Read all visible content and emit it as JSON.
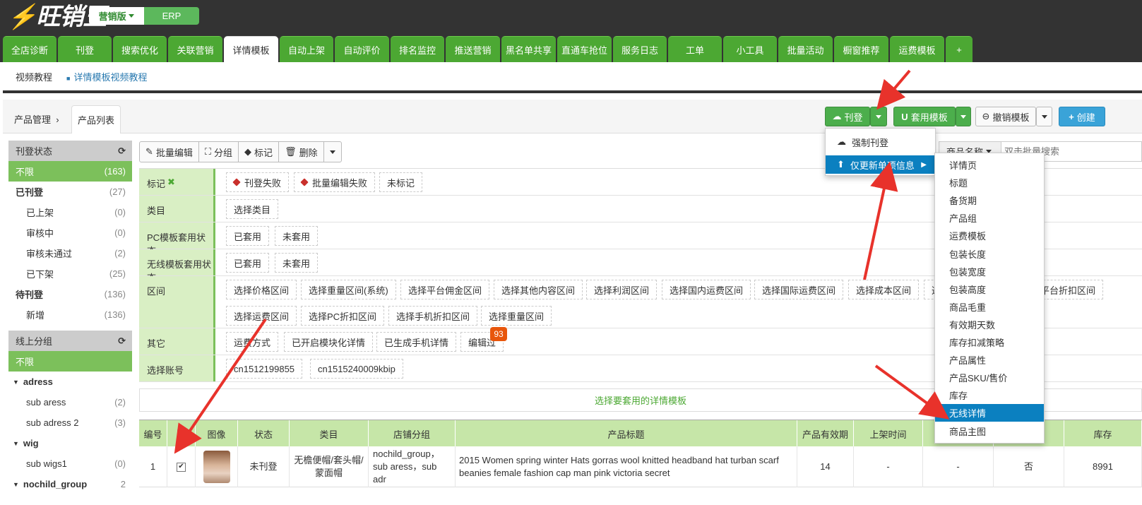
{
  "app": {
    "logo": "旺销王",
    "edition": "营销版",
    "erp": "ERP"
  },
  "nav_tabs": [
    "全店诊断",
    "刊登",
    "搜索优化",
    "关联营销",
    "详情模板",
    "自动上架",
    "自动评价",
    "排名监控",
    "推送营销",
    "黑名单共享",
    "直通车抢位",
    "服务日志",
    "工单",
    "小工具",
    "批量活动",
    "橱窗推荐",
    "运费模板",
    "+"
  ],
  "active_tab": "详情模板",
  "subnav": {
    "tutorial": "视频教程",
    "detail_tutorial": "详情模板视频教程"
  },
  "breadcrumb": {
    "parent": "产品管理",
    "current": "产品列表"
  },
  "actions": {
    "publish": "刊登",
    "apply_template": "套用模板",
    "revoke_template": "撤销模板",
    "create": "创建"
  },
  "publish_menu": {
    "force": "强制刊登",
    "update_single": "仅更新单项信息"
  },
  "update_submenu": [
    "详情页",
    "标题",
    "备货期",
    "产品组",
    "运费模板",
    "包装长度",
    "包装宽度",
    "包装高度",
    "商品毛重",
    "有效期天数",
    "库存扣减策略",
    "产品属性",
    "产品SKU/售价",
    "库存",
    "无线详情",
    "商品主图"
  ],
  "update_submenu_selected": "无线详情",
  "search": {
    "field": "商品名称",
    "placeholder": "双击批量搜索"
  },
  "sidebar": {
    "status_title": "刊登状态",
    "status_items": [
      {
        "label": "不限",
        "count": "(163)",
        "sel": true,
        "bold": false,
        "indent": false
      },
      {
        "label": "已刊登",
        "count": "(27)",
        "sel": false,
        "bold": true,
        "indent": false
      },
      {
        "label": "已上架",
        "count": "(0)",
        "sel": false,
        "bold": false,
        "indent": true
      },
      {
        "label": "审核中",
        "count": "(0)",
        "sel": false,
        "bold": false,
        "indent": true
      },
      {
        "label": "审核未通过",
        "count": "(2)",
        "sel": false,
        "bold": false,
        "indent": true
      },
      {
        "label": "已下架",
        "count": "(25)",
        "sel": false,
        "bold": false,
        "indent": true
      },
      {
        "label": "待刊登",
        "count": "(136)",
        "sel": false,
        "bold": true,
        "indent": false
      },
      {
        "label": "新增",
        "count": "(136)",
        "sel": false,
        "bold": false,
        "indent": true
      }
    ],
    "group_title": "线上分组",
    "group_items": [
      {
        "label": "不限",
        "count": "",
        "sel": true,
        "bold": false,
        "indent": false,
        "tri": false
      },
      {
        "label": "adress",
        "count": "",
        "sel": false,
        "bold": true,
        "indent": false,
        "tri": true
      },
      {
        "label": "sub aress",
        "count": "(2)",
        "sel": false,
        "bold": false,
        "indent": true,
        "tri": false
      },
      {
        "label": "sub adress 2",
        "count": "(3)",
        "sel": false,
        "bold": false,
        "indent": true,
        "tri": false
      },
      {
        "label": "wig",
        "count": "",
        "sel": false,
        "bold": true,
        "indent": false,
        "tri": true
      },
      {
        "label": "sub wigs1",
        "count": "(0)",
        "sel": false,
        "bold": false,
        "indent": true,
        "tri": false
      },
      {
        "label": "nochild_group",
        "count": "2",
        "sel": false,
        "bold": true,
        "indent": false,
        "tri": true
      }
    ]
  },
  "toolbar": {
    "batch_edit": "批量编辑",
    "group": "分组",
    "mark": "标记",
    "delete": "删除"
  },
  "filters": {
    "mark_label": "标记",
    "mark_chips": [
      "刊登失败",
      "批量编辑失败",
      "未标记"
    ],
    "category_label": "类目",
    "category_chips": [
      "选择类目"
    ],
    "pc_label": "PC模板套用状态",
    "pc_chips": [
      "已套用",
      "未套用"
    ],
    "wireless_label": "无线模板套用状态",
    "wireless_chips": [
      "已套用",
      "未套用"
    ],
    "range_label": "区间",
    "range_chips_row1": [
      "选择价格区间",
      "选择重量区间(系统)",
      "选择平台佣金区间",
      "选择其他内容区间",
      "选择利润区间",
      "选择国内运费区间",
      "选择国际运费区间",
      "选择成本区间",
      "选",
      "平台折扣区间"
    ],
    "range_chips_row2": [
      "选择运费区间",
      "选择PC折扣区间",
      "选择手机折扣区间",
      "选择重量区间"
    ],
    "other_label": "其它",
    "other_chips": [
      "运费方式",
      "已开启模块化详情",
      "已生成手机详情",
      "编辑过"
    ],
    "edited_badge": "93",
    "account_label": "选择账号",
    "account_chips": [
      "cn1512199855",
      "cn1515240009kbip"
    ]
  },
  "template_bar": "选择要套用的详情模板",
  "table": {
    "headers": [
      "编号",
      "",
      "图像",
      "状态",
      "类目",
      "店铺分组",
      "产品标题",
      "产品有效期",
      "上架时间",
      "",
      "",
      "库存"
    ],
    "rows": [
      {
        "id": "1",
        "status": "未刊登",
        "category": "无檐便帽/套头帽/蒙面帽",
        "group": "nochild_group，sub aress，sub adr",
        "title": "2015 Women spring winter Hats gorras wool knitted headband hat turban scarf beanies female fashion cap man  pink victoria secret",
        "validity": "14",
        "listed": "-",
        "c9": "-",
        "c10": "否",
        "stock": "8991"
      }
    ]
  },
  "colors": {
    "nav_green": "#4ca833",
    "active_blue": "#0b80c0",
    "arrow_red": "#e8322b",
    "header_green": "#c6e6a8"
  }
}
